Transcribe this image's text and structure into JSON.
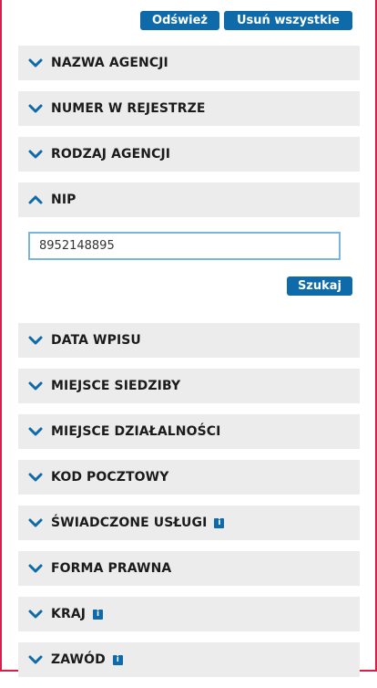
{
  "toolbar": {
    "refresh_label": "Odśwież",
    "remove_all_label": "Usuń wszystkie"
  },
  "filters": [
    {
      "label": "NAZWA AGENCJI",
      "expanded": false,
      "info": false
    },
    {
      "label": "NUMER W REJESTRZE",
      "expanded": false,
      "info": false
    },
    {
      "label": "RODZAJ AGENCJI",
      "expanded": false,
      "info": false
    },
    {
      "label": "NIP",
      "expanded": true,
      "info": false
    },
    {
      "label": "DATA WPISU",
      "expanded": false,
      "info": false
    },
    {
      "label": "MIEJSCE SIEDZIBY",
      "expanded": false,
      "info": false
    },
    {
      "label": "MIEJSCE DZIAŁALNOŚCI",
      "expanded": false,
      "info": false
    },
    {
      "label": "KOD POCZTOWY",
      "expanded": false,
      "info": false
    },
    {
      "label": "ŚWIADCZONE USŁUGI",
      "expanded": false,
      "info": true
    },
    {
      "label": "FORMA PRAWNA",
      "expanded": false,
      "info": false
    },
    {
      "label": "KRAJ",
      "expanded": false,
      "info": true
    },
    {
      "label": "ZAWÓD",
      "expanded": false,
      "info": true
    }
  ],
  "nip": {
    "value": "8952148895",
    "search_label": "Szukaj"
  },
  "info_glyph": "i",
  "colors": {
    "accent": "#0e6aa8",
    "frame": "#d6204b",
    "panel_bg": "#ececec",
    "input_border": "#7ab5dd"
  },
  "icons": {
    "collapsed": "chevron-down-icon",
    "expanded": "chevron-up-icon",
    "info": "info-icon"
  }
}
